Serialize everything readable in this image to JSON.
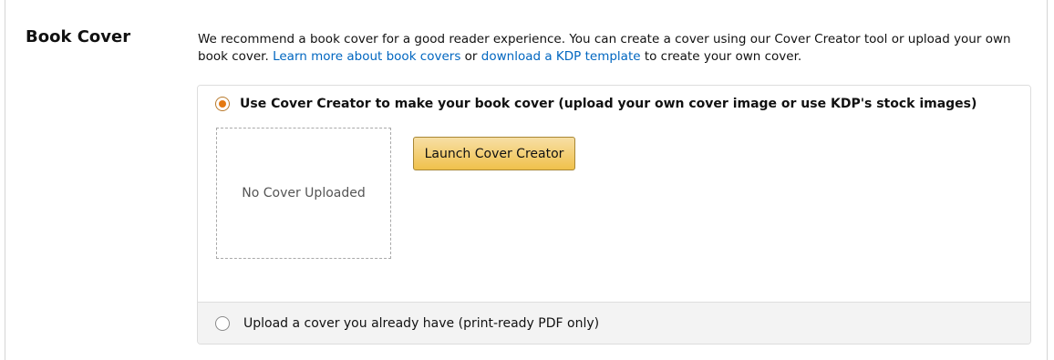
{
  "section": {
    "title": "Book Cover",
    "description_part1": "We recommend a book cover for a good reader experience. You can create a cover using our Cover Creator tool or upload your own book cover. ",
    "link_learn_more": "Learn more about book covers",
    "description_part2": " or ",
    "link_template": "download a KDP template",
    "description_part3": " to create your own cover."
  },
  "options": {
    "cover_creator": {
      "label": "Use Cover Creator to make your book cover (upload your own cover image or use KDP's stock images)",
      "selected": true,
      "placeholder_text": "No Cover Uploaded",
      "launch_button_label": "Launch Cover Creator"
    },
    "upload": {
      "label": "Upload a cover you already have (print-ready PDF only)",
      "selected": false
    }
  },
  "colors": {
    "link": "#0066c0",
    "radio_selected": "#e47911",
    "button_gradient_top": "#f7dfa5",
    "button_gradient_bottom": "#f0c14b",
    "button_border": "#a88734",
    "option_bottom_bg": "#f3f3f3"
  }
}
